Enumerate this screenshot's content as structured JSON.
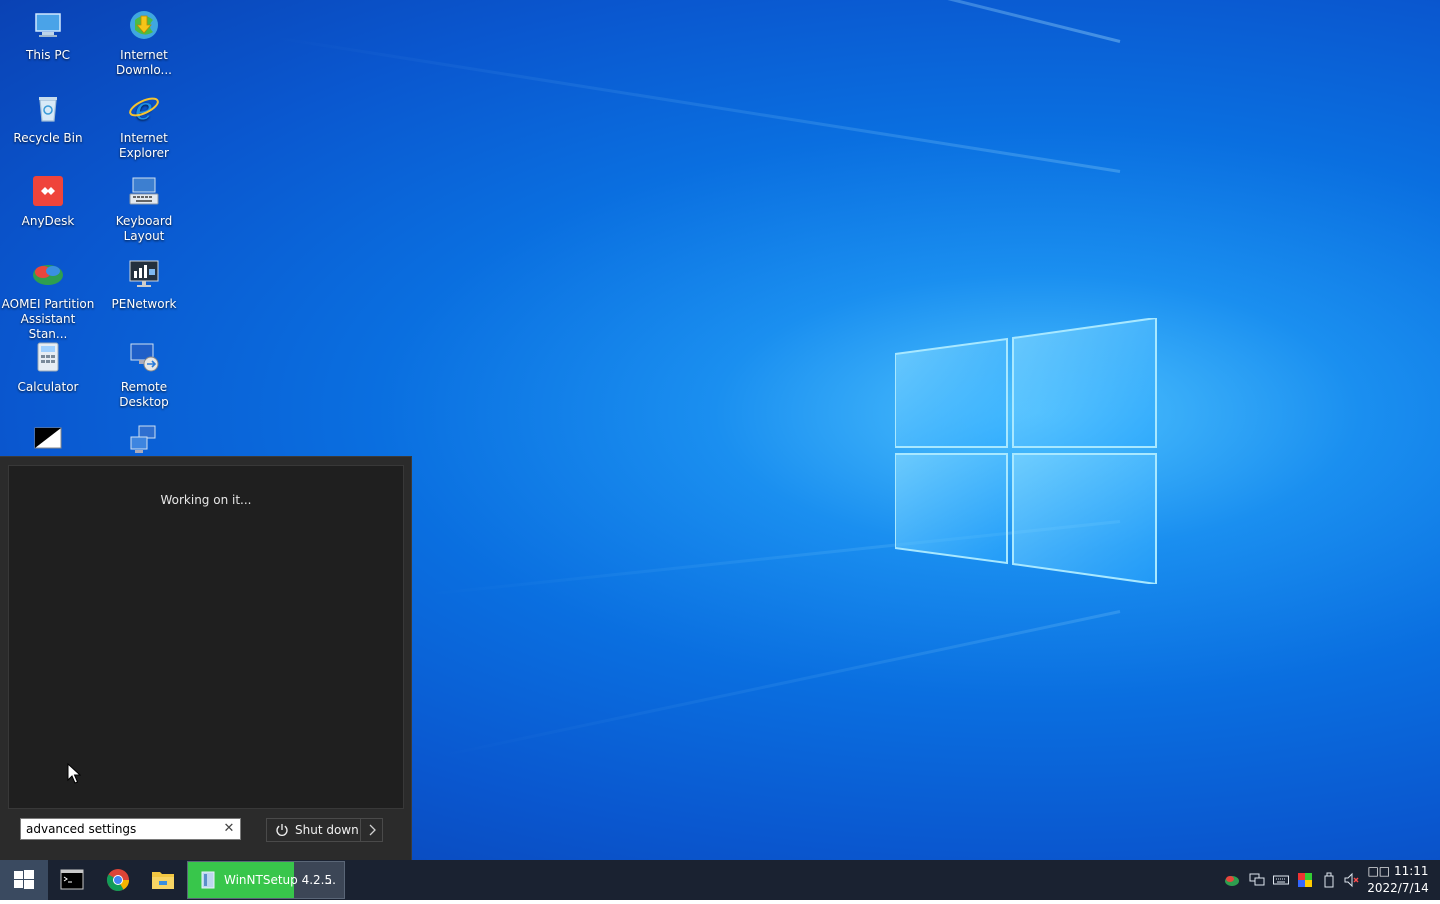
{
  "desktop": {
    "icons": [
      {
        "label": "This PC",
        "icon": "this-pc-icon"
      },
      {
        "label": "Internet Downlo...",
        "icon": "internet-download-manager-icon"
      },
      {
        "label": "Recycle Bin",
        "icon": "recycle-bin-icon"
      },
      {
        "label": "Internet Explorer",
        "icon": "internet-explorer-icon"
      },
      {
        "label": "AnyDesk",
        "icon": "anydesk-icon"
      },
      {
        "label": "Keyboard Layout",
        "icon": "keyboard-layout-icon"
      },
      {
        "label": "AOMEI Partition Assistant Stan...",
        "icon": "aomei-partition-icon"
      },
      {
        "label": "PENetwork",
        "icon": "penetwork-icon"
      },
      {
        "label": "Calculator",
        "icon": "calculator-icon"
      },
      {
        "label": "Remote Desktop",
        "icon": "remote-desktop-icon"
      }
    ]
  },
  "start_menu": {
    "status": "Working on it...",
    "search_value": "advanced settings",
    "clear_symbol": "✕",
    "shutdown_label": "Shut down",
    "arrow_symbol": "›"
  },
  "taskbar": {
    "running_task": {
      "label": "WinNTSetup 4.2.5",
      "more": "...",
      "progress": 0.68
    },
    "clock": {
      "time": "□□ 11:11",
      "date": "2022/7/14"
    }
  },
  "colors": {
    "accent_green": "#38c64b",
    "taskbar": "#1a2231",
    "menu_bg": "#1f1f1f"
  }
}
